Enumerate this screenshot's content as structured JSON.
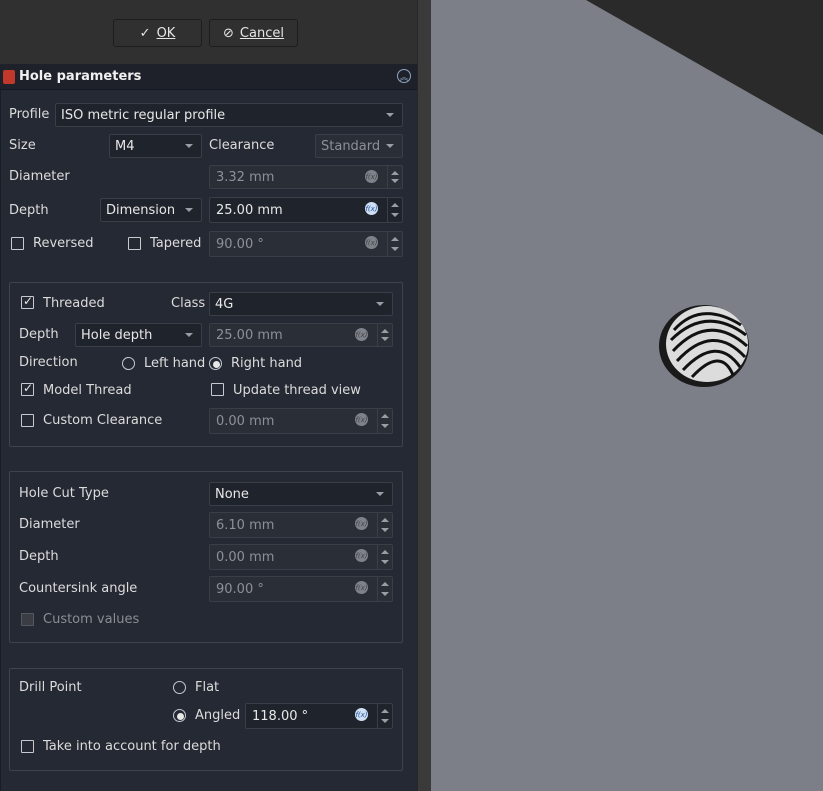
{
  "dialog": {
    "ok_label": "OK",
    "cancel_label": "Cancel"
  },
  "panel": {
    "title": "Hole parameters"
  },
  "profile": {
    "label": "Profile",
    "value": "ISO metric regular profile"
  },
  "size": {
    "label": "Size",
    "value": "M4"
  },
  "clearance": {
    "label": "Clearance",
    "value": "Standard"
  },
  "diameter": {
    "label": "Diameter",
    "value": "3.32 mm"
  },
  "depth": {
    "label": "Depth",
    "mode": "Dimension",
    "value": "25.00 mm"
  },
  "reversed": {
    "label": "Reversed",
    "checked": false
  },
  "tapered": {
    "label": "Tapered",
    "checked": false,
    "value": "90.00 °"
  },
  "thread": {
    "threaded_label": "Threaded",
    "threaded": true,
    "class_label": "Class",
    "class_value": "4G",
    "depth_label": "Depth",
    "depth_mode": "Hole depth",
    "depth_value": "25.00 mm",
    "direction_label": "Direction",
    "left_hand": "Left hand",
    "right_hand": "Right hand",
    "direction": "Right hand",
    "model_thread_label": "Model Thread",
    "model_thread": true,
    "update_view_label": "Update thread view",
    "update_view": false,
    "custom_clearance_label": "Custom Clearance",
    "custom_clearance": false,
    "custom_clearance_value": "0.00 mm"
  },
  "holecut": {
    "type_label": "Hole Cut Type",
    "type_value": "None",
    "diameter_label": "Diameter",
    "diameter_value": "6.10 mm",
    "depth_label": "Depth",
    "depth_value": "0.00 mm",
    "angle_label": "Countersink angle",
    "angle_value": "90.00 °",
    "custom_values_label": "Custom values",
    "custom_values": false
  },
  "drill": {
    "label": "Drill Point",
    "flat_label": "Flat",
    "angled_label": "Angled",
    "selected": "Angled",
    "angle_value": "118.00 °",
    "take_depth_label": "Take into account for depth",
    "take_depth": false
  },
  "colors": {
    "viewport": "#7c7f87",
    "panel": "#252933",
    "dark_shape": "#2a2a2a"
  }
}
